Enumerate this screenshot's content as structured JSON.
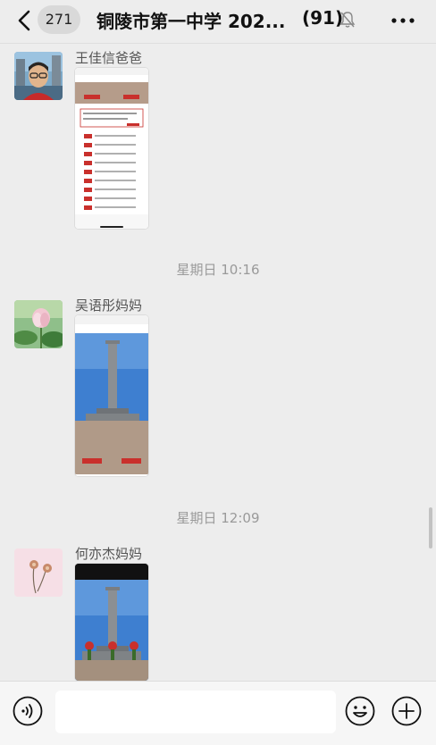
{
  "header": {
    "unread_count": "271",
    "title": "铜陵市第一中学 202...",
    "member_count": "(91)",
    "back_icon": "chevron-left-icon",
    "mute_icon": "bell-muted-icon",
    "more_icon": "more-dots-icon"
  },
  "messages": [
    {
      "sender": "王佳信爸爸",
      "attachment": "screenshot-image"
    },
    {
      "sender": "吴语彤妈妈",
      "attachment": "screenshot-image"
    },
    {
      "sender": "何亦杰妈妈",
      "attachment": "screenshot-image"
    }
  ],
  "timestamps": [
    "星期日 10:16",
    "星期日 12:09"
  ],
  "input_bar": {
    "voice_icon": "voice-icon",
    "emoji_icon": "emoji-icon",
    "plus_icon": "plus-icon"
  },
  "colors": {
    "background": "#ededed",
    "header_bg": "#ededed",
    "accent_red": "#c9302c",
    "sky_blue": "#3e7fd0",
    "input_bg": "#f6f6f6"
  }
}
